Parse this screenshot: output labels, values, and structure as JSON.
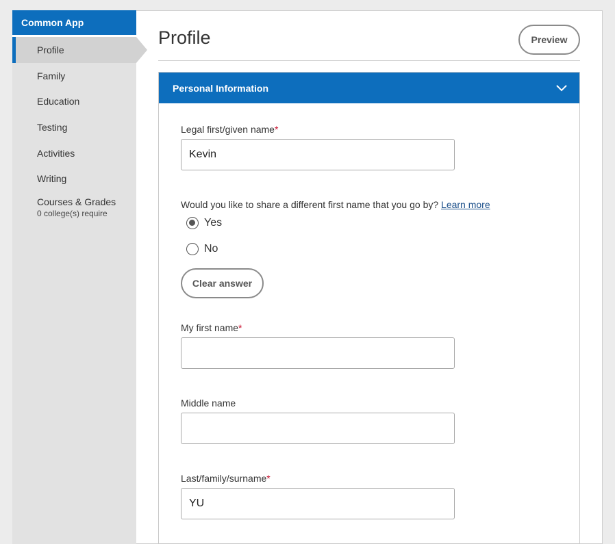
{
  "sidebar": {
    "app_name": "Common App",
    "items": [
      {
        "label": "Profile"
      },
      {
        "label": "Family"
      },
      {
        "label": "Education"
      },
      {
        "label": "Testing"
      },
      {
        "label": "Activities"
      },
      {
        "label": "Writing"
      },
      {
        "label": "Courses & Grades",
        "sub": "0 college(s) require"
      }
    ],
    "active_item": "Profile"
  },
  "header": {
    "title": "Profile",
    "preview_label": "Preview"
  },
  "section": {
    "title": "Personal Information",
    "toggle_icon": "chevron-down-icon"
  },
  "form": {
    "legal_first_name": {
      "label": "Legal first/given name",
      "required_mark": "*",
      "value": "Kevin"
    },
    "different_name_question": {
      "text": "Would you like to share a different first name that you go by?",
      "link": "Learn more",
      "options": [
        {
          "label": "Yes",
          "checked": true
        },
        {
          "label": "No",
          "checked": false
        }
      ],
      "clear_label": "Clear answer"
    },
    "my_first_name": {
      "label": "My first name",
      "required_mark": "*",
      "value": ""
    },
    "middle_name": {
      "label": "Middle name",
      "value": ""
    },
    "last_name": {
      "label": "Last/family/surname",
      "required_mark": "*",
      "value": "YU"
    }
  },
  "colors": {
    "brand_blue": "#0d6ebd",
    "required_red": "#c8102e"
  }
}
